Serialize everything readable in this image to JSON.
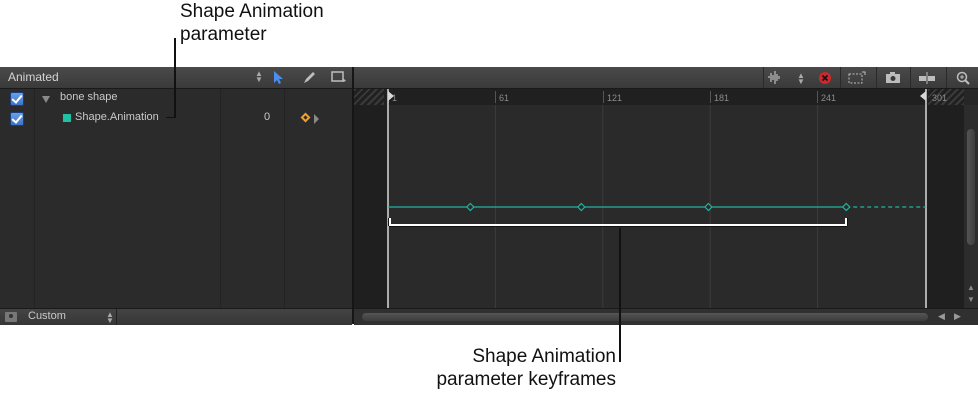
{
  "callouts": {
    "top_line1": "Shape Animation",
    "top_line2": "parameter",
    "bottom_line1": "Shape Animation",
    "bottom_line2": "parameter keyframes"
  },
  "left_panel": {
    "header": {
      "title": "Animated"
    },
    "rows": [
      {
        "label": "bone shape",
        "checked": true,
        "expanded": true
      },
      {
        "label": "Shape.Animation",
        "checked": true,
        "value": "0",
        "color": "#1fc0a4"
      }
    ],
    "footer": {
      "label": "Custom"
    }
  },
  "timeline": {
    "ruler_labels": [
      "1",
      "61",
      "121",
      "181",
      "241",
      "301"
    ],
    "keyframe_frames": [
      1,
      47,
      109,
      180,
      257
    ],
    "curve_color": "#22b3a0"
  },
  "colors": {
    "keyframe_nav": "#f0a030",
    "delete_button": "#d0262c",
    "arrow_tool": "#4a8ff0"
  }
}
